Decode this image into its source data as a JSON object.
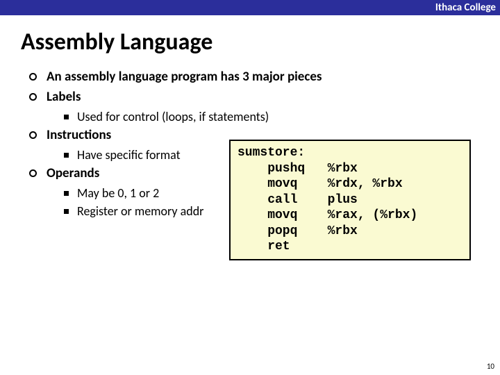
{
  "header": {
    "org": "Ithaca College"
  },
  "title": "Assembly Language",
  "bullets": {
    "b1": "An assembly language program has 3 major pieces",
    "b2": "Labels",
    "b2s1": "Used for control (loops, if statements)",
    "b3": "Instructions",
    "b3s1": "Have specific format",
    "b4": "Operands",
    "b4s1": "May be 0, 1 or 2",
    "b4s2": "Register or memory addr"
  },
  "code": {
    "l0": "sumstore:",
    "l1": "    pushq   %rbx",
    "l2": "    movq    %rdx, %rbx",
    "l3": "    call    plus",
    "l4": "    movq    %rax, (%rbx)",
    "l5": "    popq    %rbx",
    "l6": "    ret"
  },
  "page": "10"
}
